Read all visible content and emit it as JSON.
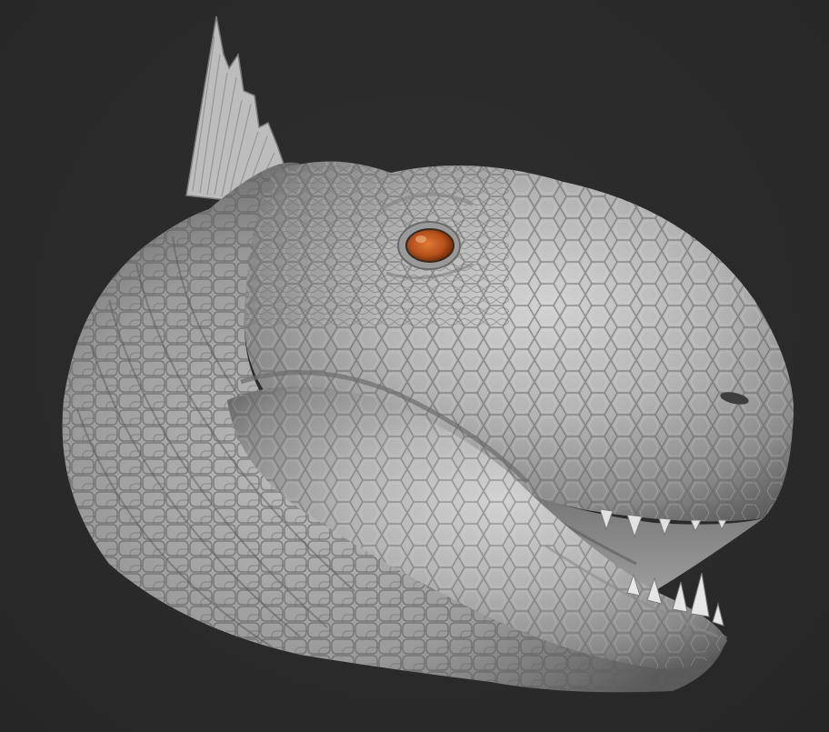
{
  "scene": {
    "background_color": "#2a2a2a",
    "subject": "dinosaur-head-sculpt",
    "material": "clay-render",
    "surface_color": "#b8b8b8",
    "eye_color": "#b5501c",
    "texture": "reptile-scales"
  }
}
